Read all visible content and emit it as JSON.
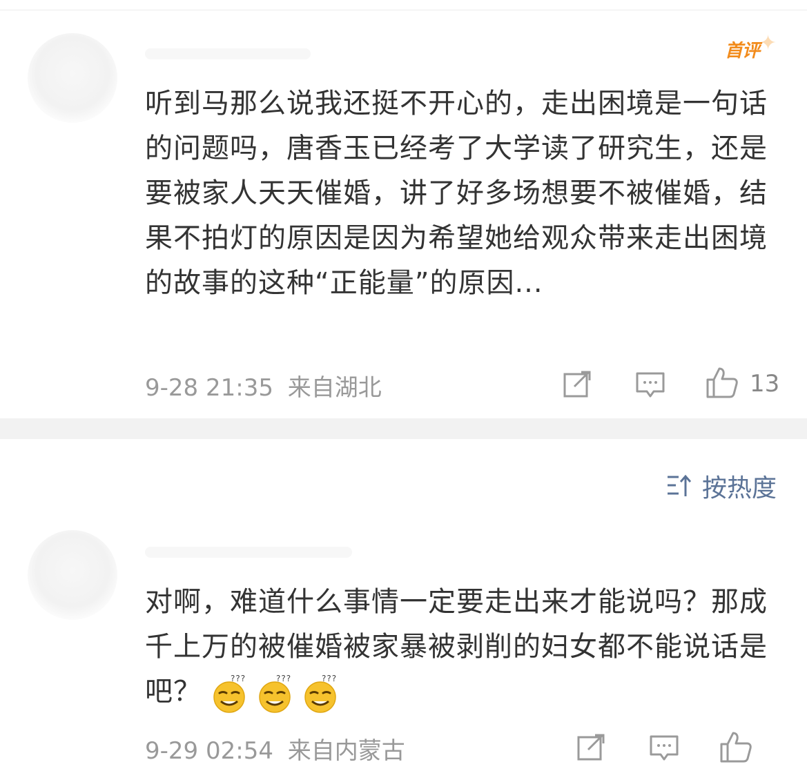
{
  "badge": {
    "label": "首评"
  },
  "comments": [
    {
      "text": "听到马那么说我还挺不开心的，走出困境是一句话的问题吗，唐香玉已经考了大学读了研究生，还是要被家人天天催婚，讲了好多场想要不被催婚，结果不拍灯的原因是因为希望她给观众带来走出困境的故事的这种“正能量”的原因...",
      "date": "9-28 21:35",
      "location": "来自湖北",
      "likes": "13"
    },
    {
      "text": "对啊，难道什么事情一定要走出来才能说吗？那成千上万的被催婚被家暴被剥削的妇女都不能说话是吧？",
      "date": "9-29 02:54",
      "location": "来自内蒙古",
      "emojis": [
        "smirk-sweat-emoji",
        "smirk-sweat-emoji",
        "smirk-sweat-emoji"
      ]
    }
  ],
  "sort": {
    "label": "按热度",
    "icon": "sort-icon"
  },
  "icons": {
    "repost": "repost-icon",
    "comment": "comment-icon",
    "like": "thumbs-up-icon"
  },
  "colors": {
    "badge": "#f28b1b",
    "link": "#5b7397",
    "meta": "#999999",
    "text": "#333333"
  }
}
